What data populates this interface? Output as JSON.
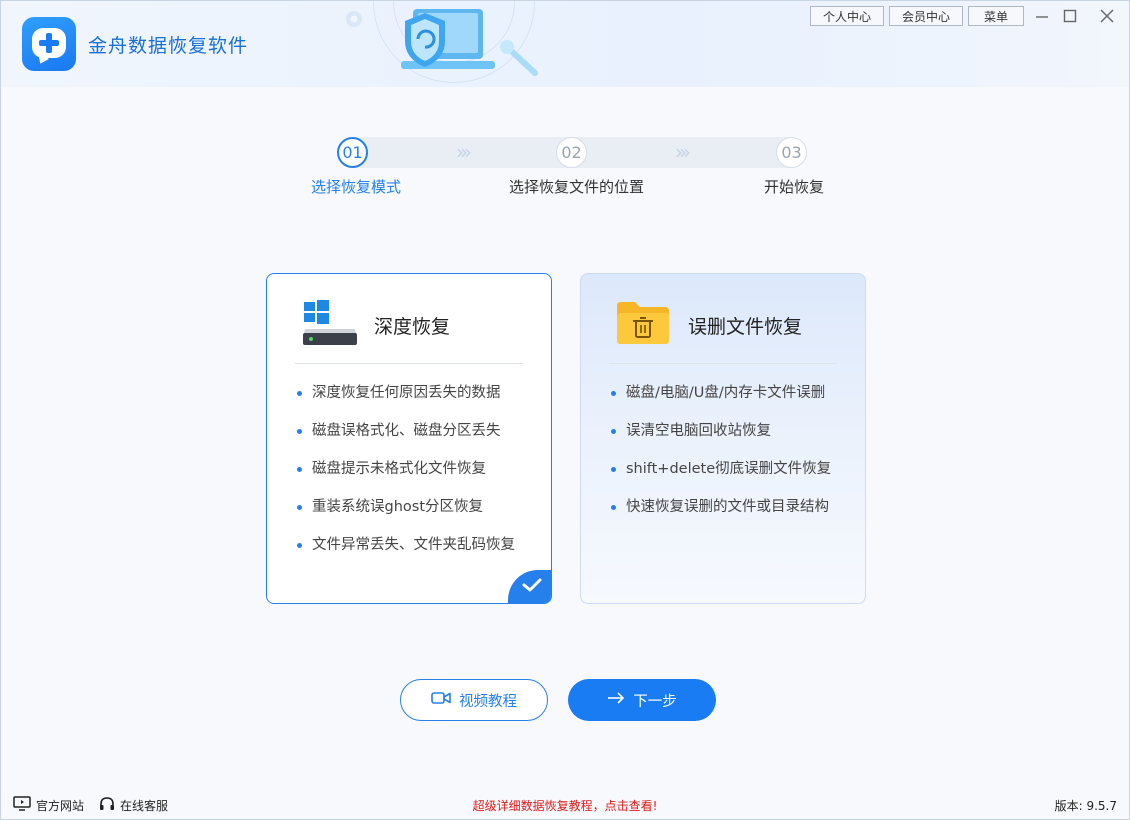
{
  "app": {
    "title": "金舟数据恢复软件"
  },
  "topbar": {
    "personal": "个人中心",
    "member": "会员中心",
    "menu": "菜单"
  },
  "steps": [
    {
      "num": "01",
      "label": "选择恢复模式",
      "active": true
    },
    {
      "num": "02",
      "label": "选择恢复文件的位置",
      "active": false
    },
    {
      "num": "03",
      "label": "开始恢复",
      "active": false
    }
  ],
  "cards": {
    "deep": {
      "title": "深度恢复",
      "selected": true,
      "items": [
        "深度恢复任何原因丢失的数据",
        "磁盘误格式化、磁盘分区丢失",
        "磁盘提示未格式化文件恢复",
        "重装系统误ghost分区恢复",
        "文件异常丢失、文件夹乱码恢复"
      ]
    },
    "deleted": {
      "title": "误删文件恢复",
      "selected": false,
      "items": [
        "磁盘/电脑/U盘/内存卡文件误删",
        "误清空电脑回收站恢复",
        "shift+delete彻底误删文件恢复",
        "快速恢复误删的文件或目录结构"
      ]
    }
  },
  "actions": {
    "video": "视频教程",
    "next": "下一步"
  },
  "footer": {
    "website": "官方网站",
    "support": "在线客服",
    "promo": "超级详细数据恢复教程，点击查看!",
    "version": "版本: 9.5.7"
  },
  "colors": {
    "accent": "#2680eb",
    "promo": "#e01b1b"
  }
}
